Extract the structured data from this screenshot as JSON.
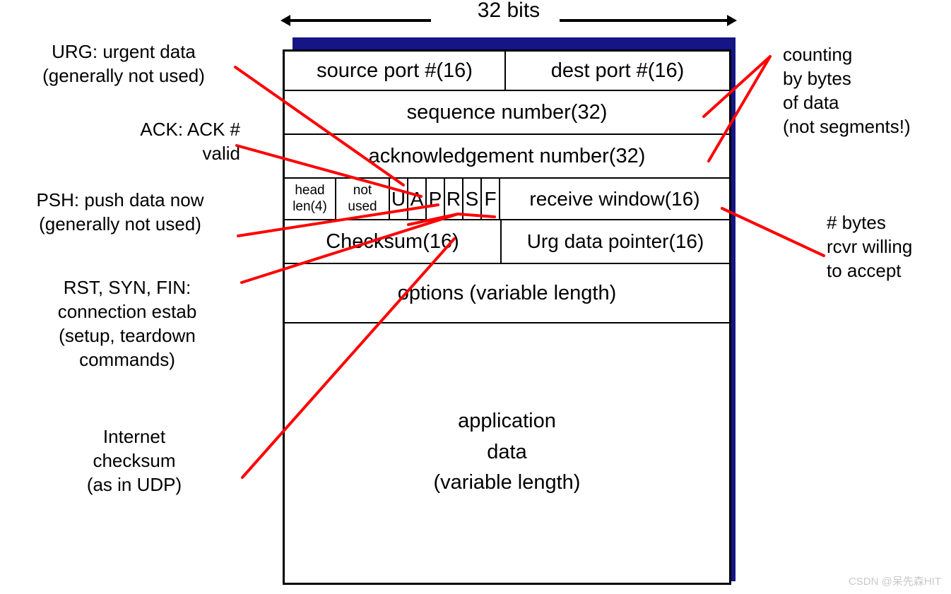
{
  "header": {
    "bits_label": "32 bits",
    "arrow_left_icon": "arrow-left-icon",
    "arrow_right_icon": "arrow-right-icon"
  },
  "colors": {
    "shadow_blue": "#151585",
    "leader_red": "#FF0000",
    "border_black": "#000000",
    "background": "#FFFFFF",
    "watermark_gray": "#C9C9C9"
  },
  "tcp_header": {
    "rows": [
      {
        "name": "ports",
        "cells": [
          {
            "label": "source port #(16)"
          },
          {
            "label": "dest port #(16)"
          }
        ]
      },
      {
        "name": "sequence",
        "cells": [
          {
            "label": "sequence number(32)"
          }
        ]
      },
      {
        "name": "acknowledgement",
        "cells": [
          {
            "label": "acknowledgement number(32)"
          }
        ]
      },
      {
        "name": "flags",
        "cells": [
          {
            "label": "head\nlen(4)"
          },
          {
            "label": "not\nused"
          },
          {
            "label": "U"
          },
          {
            "label": "A"
          },
          {
            "label": "P"
          },
          {
            "label": "R"
          },
          {
            "label": "S"
          },
          {
            "label": "F"
          },
          {
            "label": "receive window(16)"
          }
        ]
      },
      {
        "name": "checksum",
        "cells": [
          {
            "label": "Checksum(16)"
          },
          {
            "label": "Urg data pointer(16)"
          }
        ]
      },
      {
        "name": "options",
        "cells": [
          {
            "label": "options (variable length)"
          }
        ]
      },
      {
        "name": "application-data",
        "cells": [
          {
            "label": "application\ndata\n(variable length)"
          }
        ]
      }
    ],
    "field_labels": {
      "source_port": "source port #(16)",
      "dest_port": "dest port #(16)",
      "sequence_number": "sequence number(32)",
      "ack_number": "acknowledgement number(32)",
      "head_len_line1": "head",
      "head_len_line2": "len(4)",
      "not_used_line1": "not",
      "not_used_line2": "used",
      "flag_u": "U",
      "flag_a": "A",
      "flag_p": "P",
      "flag_r": "R",
      "flag_s": "S",
      "flag_f": "F",
      "receive_window": "receive window(16)",
      "checksum": "Checksum(16)",
      "urg_data_pointer": "Urg data pointer(16)",
      "options": "options (variable length)",
      "app_data_line1": "application",
      "app_data_line2": "data",
      "app_data_line3": "(variable length)"
    }
  },
  "annotations": {
    "urg": "URG: urgent data\n(generally not used)",
    "ack": "ACK: ACK #\nvalid",
    "psh": "PSH: push data now\n(generally not used)",
    "rst_syn_fin": "RST, SYN, FIN:\nconnection estab\n(setup, teardown\ncommands)",
    "internet_checksum": "Internet\nchecksum\n(as in UDP)",
    "counting": "counting\nby bytes\nof data\n(not segments!)",
    "rcvr_bytes": "# bytes\nrcvr willing\nto accept"
  },
  "watermark": {
    "text": "CSDN @呆先森HIT"
  }
}
